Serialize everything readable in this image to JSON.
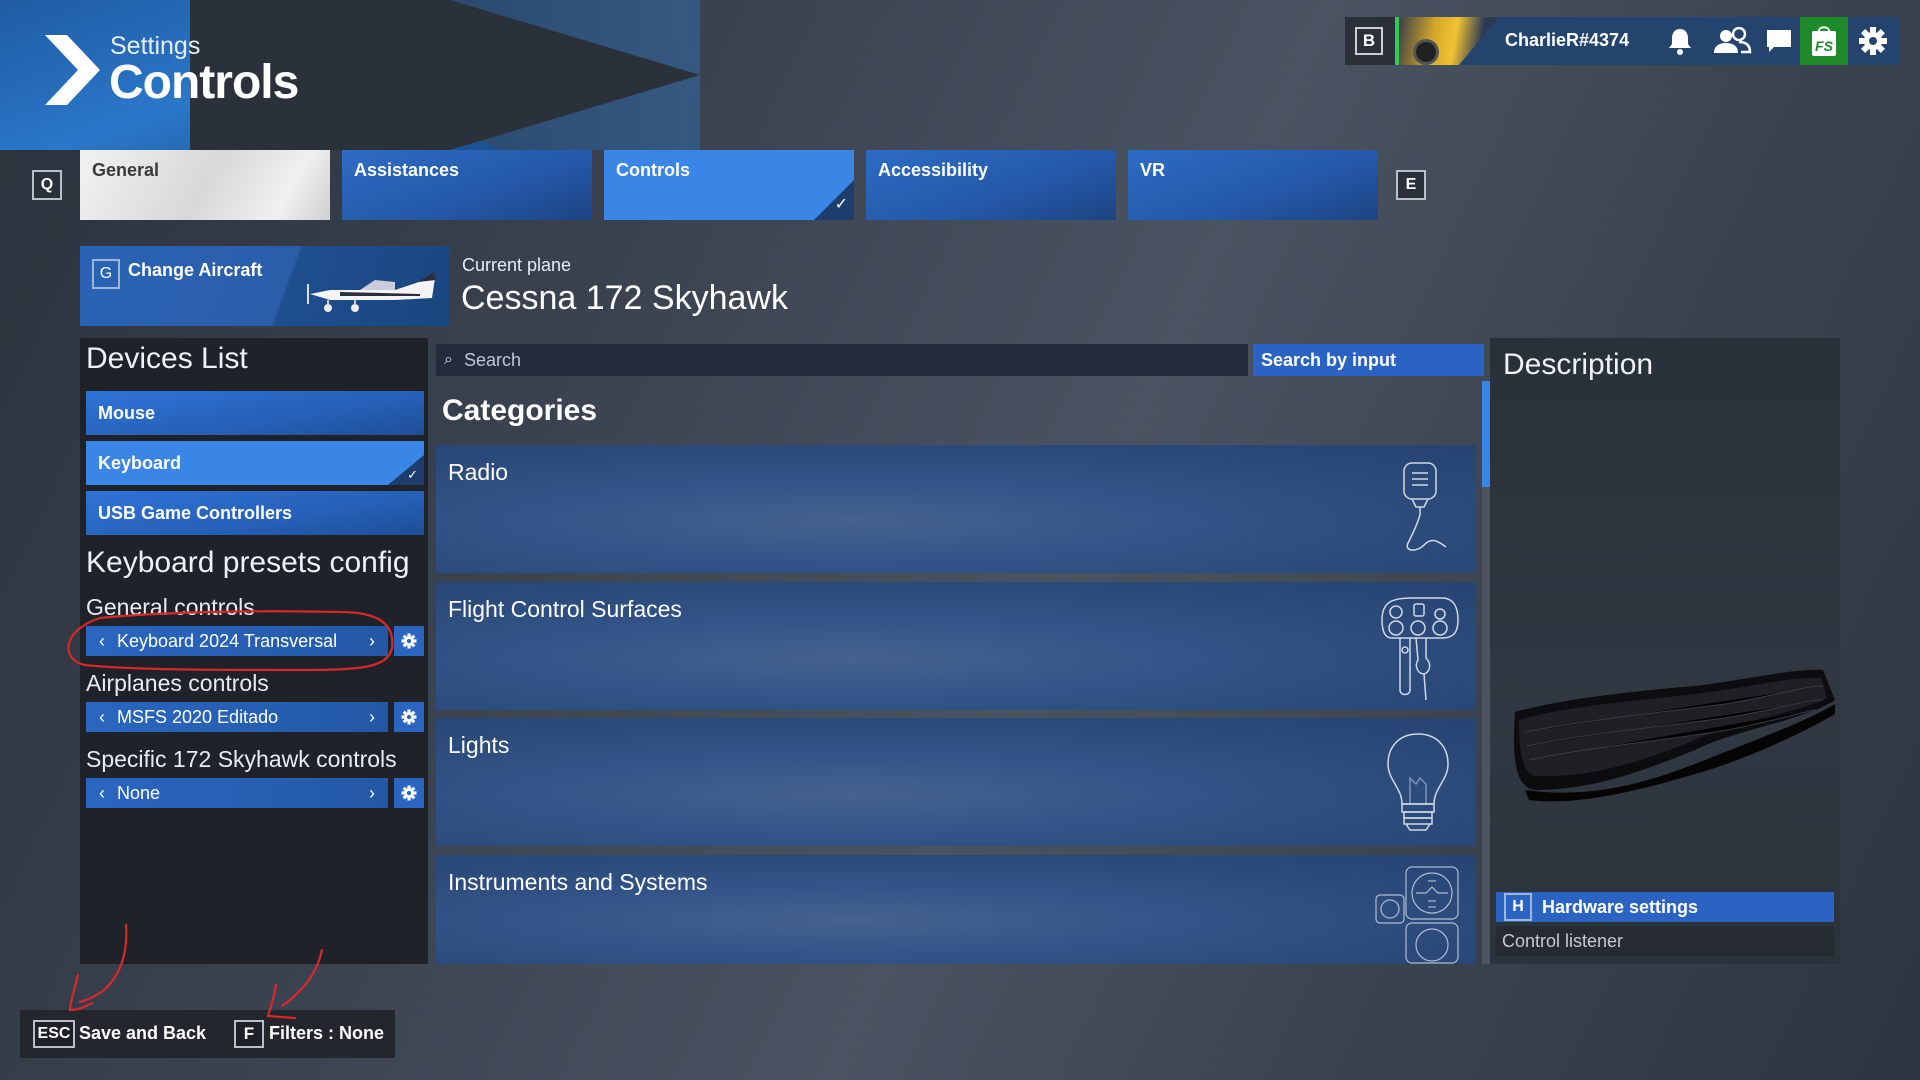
{
  "header": {
    "subtitle": "Settings",
    "title": "Controls"
  },
  "topbar": {
    "key_hint": "B",
    "username": "CharlieR#4374",
    "icons": [
      "bell-icon",
      "friends-icon",
      "chat-icon",
      "marketplace-icon",
      "settings-gear-icon"
    ],
    "store_label": "FS",
    "colors": {
      "bar": "#24446e",
      "online": "#2ecc55",
      "store": "#1e8a2c"
    }
  },
  "tabs": {
    "prev_key": "Q",
    "next_key": "E",
    "items": [
      {
        "label": "General",
        "state": "focused"
      },
      {
        "label": "Assistances",
        "state": "normal"
      },
      {
        "label": "Controls",
        "state": "selected"
      },
      {
        "label": "Accessibility",
        "state": "normal"
      },
      {
        "label": "VR",
        "state": "normal"
      }
    ],
    "check_glyph": "✓"
  },
  "aircraft": {
    "key_hint": "G",
    "change_label": "Change Aircraft",
    "current_label": "Current plane",
    "current_name": "Cessna 172 Skyhawk"
  },
  "devices": {
    "title": "Devices List",
    "items": [
      {
        "label": "Mouse",
        "selected": false
      },
      {
        "label": "Keyboard",
        "selected": true
      },
      {
        "label": "USB Game Controllers",
        "selected": false
      }
    ]
  },
  "presets": {
    "title": "Keyboard presets config",
    "groups": [
      {
        "label": "General controls",
        "value": "Keyboard 2024 Transversal"
      },
      {
        "label": "Airplanes controls",
        "value": "MSFS 2020 Editado"
      },
      {
        "label": "Specific 172 Skyhawk controls",
        "value": "None"
      }
    ],
    "prev_glyph": "‹",
    "next_glyph": "›"
  },
  "search": {
    "placeholder": "Search",
    "by_input_label": "Search by input"
  },
  "categories": {
    "title": "Categories",
    "items": [
      {
        "label": "Radio",
        "icon": "radio-microphone-icon"
      },
      {
        "label": "Flight Control Surfaces",
        "icon": "yoke-icon"
      },
      {
        "label": "Lights",
        "icon": "light-bulb-icon"
      },
      {
        "label": "Instruments and Systems",
        "icon": "gauges-icon"
      }
    ],
    "scroll_position": 0.0,
    "scroll_visible_fraction": 0.18
  },
  "description": {
    "title": "Description",
    "device_image": "keyboard-image",
    "hardware_key": "H",
    "hardware_label": "Hardware settings",
    "listener_label": "Control listener"
  },
  "footer": {
    "back_key": "ESC",
    "back_label": "Save and Back",
    "filter_key": "F",
    "filter_label": "Filters : None"
  },
  "colors": {
    "accent": "#3a86e6",
    "tile": "#2458a8",
    "annotation": "#d8282a"
  }
}
